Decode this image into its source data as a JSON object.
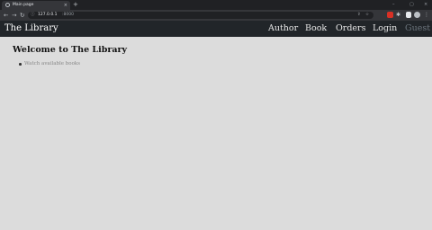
{
  "browser": {
    "tab": {
      "title": "Main page",
      "close": "×"
    },
    "new_tab": "+",
    "window_controls": {
      "minimize": "–",
      "maximize": "▢",
      "close": "×"
    },
    "nav": {
      "back": "←",
      "forward": "→",
      "reload": "↻"
    },
    "address": {
      "lock_icon": "ⓘ",
      "host": "127.0.0.1",
      "port": ":8000"
    },
    "colors": {
      "chrome_dark": "#202124",
      "chrome_toolbar": "#35363a",
      "ext_red": "#d93025"
    }
  },
  "site": {
    "navbar": {
      "brand": "The Library",
      "links": [
        {
          "label": "Author",
          "active": true
        },
        {
          "label": "Book",
          "active": true
        },
        {
          "label": "Orders",
          "active": true
        },
        {
          "label": "Login",
          "active": true
        },
        {
          "label": "Guest",
          "active": false
        }
      ],
      "colors": {
        "background": "#212529",
        "link": "#e6e6e6",
        "muted": "#6c757d"
      }
    },
    "main": {
      "heading": "Welcome to The Library",
      "items": [
        "Watch available books"
      ]
    },
    "page_background": "#dcdcdc"
  }
}
